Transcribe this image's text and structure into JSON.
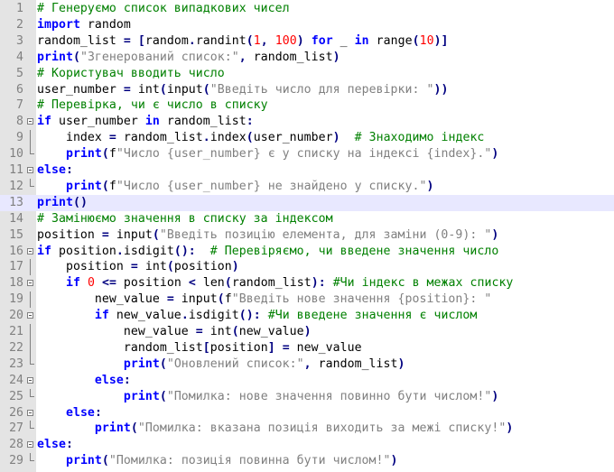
{
  "editor": {
    "language": "python",
    "current_line": 13,
    "colors": {
      "comment": "#008000",
      "keyword": "#0000ff",
      "string": "#808080",
      "number": "#ff0000",
      "operator": "#000080",
      "gutter": "#e4e4e4",
      "current_line": "#e8e8ff"
    },
    "lines": [
      {
        "n": "1",
        "fold": "",
        "tokens": [
          {
            "c": "comment",
            "t": "# Генеруємо список випадкових чисел"
          }
        ]
      },
      {
        "n": "2",
        "fold": "",
        "tokens": [
          {
            "c": "kw",
            "t": "import"
          },
          {
            "c": "id",
            "t": " random"
          }
        ]
      },
      {
        "n": "3",
        "fold": "",
        "tokens": [
          {
            "c": "id",
            "t": "random_list "
          },
          {
            "c": "op",
            "t": "="
          },
          {
            "c": "id",
            "t": " "
          },
          {
            "c": "op",
            "t": "["
          },
          {
            "c": "id",
            "t": "random"
          },
          {
            "c": "op",
            "t": "."
          },
          {
            "c": "id",
            "t": "randint"
          },
          {
            "c": "op",
            "t": "("
          },
          {
            "c": "num",
            "t": "1"
          },
          {
            "c": "op",
            "t": ","
          },
          {
            "c": "id",
            "t": " "
          },
          {
            "c": "num",
            "t": "100"
          },
          {
            "c": "op",
            "t": ")"
          },
          {
            "c": "id",
            "t": " "
          },
          {
            "c": "kw",
            "t": "for"
          },
          {
            "c": "id",
            "t": " _ "
          },
          {
            "c": "kw",
            "t": "in"
          },
          {
            "c": "id",
            "t": " range"
          },
          {
            "c": "op",
            "t": "("
          },
          {
            "c": "num",
            "t": "10"
          },
          {
            "c": "op",
            "t": ")]"
          }
        ]
      },
      {
        "n": "4",
        "fold": "",
        "tokens": [
          {
            "c": "kw",
            "t": "print"
          },
          {
            "c": "op",
            "t": "("
          },
          {
            "c": "str",
            "t": "\"Згенерований список:\""
          },
          {
            "c": "op",
            "t": ","
          },
          {
            "c": "id",
            "t": " random_list"
          },
          {
            "c": "op",
            "t": ")"
          }
        ]
      },
      {
        "n": "5",
        "fold": "",
        "tokens": [
          {
            "c": "comment",
            "t": "# Користувач вводить число"
          }
        ]
      },
      {
        "n": "6",
        "fold": "",
        "tokens": [
          {
            "c": "id",
            "t": "user_number "
          },
          {
            "c": "op",
            "t": "="
          },
          {
            "c": "id",
            "t": " int"
          },
          {
            "c": "op",
            "t": "("
          },
          {
            "c": "id",
            "t": "input"
          },
          {
            "c": "op",
            "t": "("
          },
          {
            "c": "str",
            "t": "\"Введіть число для перевірки: \""
          },
          {
            "c": "op",
            "t": "))"
          }
        ]
      },
      {
        "n": "7",
        "fold": "",
        "tokens": [
          {
            "c": "comment",
            "t": "# Перевірка, чи є число в списку"
          }
        ]
      },
      {
        "n": "8",
        "fold": "box",
        "tokens": [
          {
            "c": "kw",
            "t": "if"
          },
          {
            "c": "id",
            "t": " user_number "
          },
          {
            "c": "kw",
            "t": "in"
          },
          {
            "c": "id",
            "t": " random_list"
          },
          {
            "c": "op",
            "t": ":"
          }
        ]
      },
      {
        "n": "9",
        "fold": "line",
        "tokens": [
          {
            "c": "id",
            "t": "    index "
          },
          {
            "c": "op",
            "t": "="
          },
          {
            "c": "id",
            "t": " random_list"
          },
          {
            "c": "op",
            "t": "."
          },
          {
            "c": "id",
            "t": "index"
          },
          {
            "c": "op",
            "t": "("
          },
          {
            "c": "id",
            "t": "user_number"
          },
          {
            "c": "op",
            "t": ")"
          },
          {
            "c": "id",
            "t": "  "
          },
          {
            "c": "comment",
            "t": "# Знаходимо індекс"
          }
        ]
      },
      {
        "n": "10",
        "fold": "end",
        "tokens": [
          {
            "c": "id",
            "t": "    "
          },
          {
            "c": "kw",
            "t": "print"
          },
          {
            "c": "op",
            "t": "("
          },
          {
            "c": "id",
            "t": "f"
          },
          {
            "c": "str",
            "t": "\"Число {user_number} є у списку на індексі {index}.\""
          },
          {
            "c": "op",
            "t": ")"
          }
        ]
      },
      {
        "n": "11",
        "fold": "box",
        "tokens": [
          {
            "c": "kw",
            "t": "else"
          },
          {
            "c": "op",
            "t": ":"
          }
        ]
      },
      {
        "n": "12",
        "fold": "end",
        "tokens": [
          {
            "c": "id",
            "t": "    "
          },
          {
            "c": "kw",
            "t": "print"
          },
          {
            "c": "op",
            "t": "("
          },
          {
            "c": "id",
            "t": "f"
          },
          {
            "c": "str",
            "t": "\"Число {user_number} не знайдено у списку.\""
          },
          {
            "c": "op",
            "t": ")"
          }
        ]
      },
      {
        "n": "13",
        "fold": "",
        "tokens": [
          {
            "c": "kw",
            "t": "print"
          },
          {
            "c": "op",
            "t": "()"
          }
        ]
      },
      {
        "n": "14",
        "fold": "",
        "tokens": [
          {
            "c": "comment",
            "t": "# Замінюємо значення в списку за індексом"
          }
        ]
      },
      {
        "n": "15",
        "fold": "",
        "tokens": [
          {
            "c": "id",
            "t": "position "
          },
          {
            "c": "op",
            "t": "="
          },
          {
            "c": "id",
            "t": " input"
          },
          {
            "c": "op",
            "t": "("
          },
          {
            "c": "str",
            "t": "\"Введіть позицію елемента, для заміни (0-9): \""
          },
          {
            "c": "op",
            "t": ")"
          }
        ]
      },
      {
        "n": "16",
        "fold": "box",
        "tokens": [
          {
            "c": "kw",
            "t": "if"
          },
          {
            "c": "id",
            "t": " position"
          },
          {
            "c": "op",
            "t": "."
          },
          {
            "c": "id",
            "t": "isdigit"
          },
          {
            "c": "op",
            "t": "():"
          },
          {
            "c": "id",
            "t": "  "
          },
          {
            "c": "comment",
            "t": "# Перевіряємо, чи введене значення число"
          }
        ]
      },
      {
        "n": "17",
        "fold": "line",
        "tokens": [
          {
            "c": "id",
            "t": "    position "
          },
          {
            "c": "op",
            "t": "="
          },
          {
            "c": "id",
            "t": " int"
          },
          {
            "c": "op",
            "t": "("
          },
          {
            "c": "id",
            "t": "position"
          },
          {
            "c": "op",
            "t": ")"
          }
        ]
      },
      {
        "n": "18",
        "fold": "box",
        "tokens": [
          {
            "c": "id",
            "t": "    "
          },
          {
            "c": "kw",
            "t": "if"
          },
          {
            "c": "id",
            "t": " "
          },
          {
            "c": "num",
            "t": "0"
          },
          {
            "c": "id",
            "t": " "
          },
          {
            "c": "op",
            "t": "<="
          },
          {
            "c": "id",
            "t": " position "
          },
          {
            "c": "op",
            "t": "<"
          },
          {
            "c": "id",
            "t": " len"
          },
          {
            "c": "op",
            "t": "("
          },
          {
            "c": "id",
            "t": "random_list"
          },
          {
            "c": "op",
            "t": "):"
          },
          {
            "c": "id",
            "t": " "
          },
          {
            "c": "comment",
            "t": "#Чи індекс в межах списку"
          }
        ]
      },
      {
        "n": "19",
        "fold": "line",
        "tokens": [
          {
            "c": "id",
            "t": "        new_value "
          },
          {
            "c": "op",
            "t": "="
          },
          {
            "c": "id",
            "t": " input"
          },
          {
            "c": "op",
            "t": "("
          },
          {
            "c": "id",
            "t": "f"
          },
          {
            "c": "str",
            "t": "\"Введіть нове значення {position}: \""
          }
        ]
      },
      {
        "n": "20",
        "fold": "box",
        "tokens": [
          {
            "c": "id",
            "t": "        "
          },
          {
            "c": "kw",
            "t": "if"
          },
          {
            "c": "id",
            "t": " new_value"
          },
          {
            "c": "op",
            "t": "."
          },
          {
            "c": "id",
            "t": "isdigit"
          },
          {
            "c": "op",
            "t": "():"
          },
          {
            "c": "id",
            "t": " "
          },
          {
            "c": "comment",
            "t": "#Чи введене значення є числом"
          }
        ]
      },
      {
        "n": "21",
        "fold": "line",
        "tokens": [
          {
            "c": "id",
            "t": "            new_value "
          },
          {
            "c": "op",
            "t": "="
          },
          {
            "c": "id",
            "t": " int"
          },
          {
            "c": "op",
            "t": "("
          },
          {
            "c": "id",
            "t": "new_value"
          },
          {
            "c": "op",
            "t": ")"
          }
        ]
      },
      {
        "n": "22",
        "fold": "line",
        "tokens": [
          {
            "c": "id",
            "t": "            random_list"
          },
          {
            "c": "op",
            "t": "["
          },
          {
            "c": "id",
            "t": "position"
          },
          {
            "c": "op",
            "t": "]"
          },
          {
            "c": "id",
            "t": " "
          },
          {
            "c": "op",
            "t": "="
          },
          {
            "c": "id",
            "t": " new_value"
          }
        ]
      },
      {
        "n": "23",
        "fold": "end",
        "tokens": [
          {
            "c": "id",
            "t": "            "
          },
          {
            "c": "kw",
            "t": "print"
          },
          {
            "c": "op",
            "t": "("
          },
          {
            "c": "str",
            "t": "\"Оновлений список:\""
          },
          {
            "c": "op",
            "t": ","
          },
          {
            "c": "id",
            "t": " random_list"
          },
          {
            "c": "op",
            "t": ")"
          }
        ]
      },
      {
        "n": "24",
        "fold": "box",
        "tokens": [
          {
            "c": "id",
            "t": "        "
          },
          {
            "c": "kw",
            "t": "else"
          },
          {
            "c": "op",
            "t": ":"
          }
        ]
      },
      {
        "n": "25",
        "fold": "end",
        "tokens": [
          {
            "c": "id",
            "t": "            "
          },
          {
            "c": "kw",
            "t": "print"
          },
          {
            "c": "op",
            "t": "("
          },
          {
            "c": "str",
            "t": "\"Помилка: нове значення повинно бути числом!\""
          },
          {
            "c": "op",
            "t": ")"
          }
        ]
      },
      {
        "n": "26",
        "fold": "box",
        "tokens": [
          {
            "c": "id",
            "t": "    "
          },
          {
            "c": "kw",
            "t": "else"
          },
          {
            "c": "op",
            "t": ":"
          }
        ]
      },
      {
        "n": "27",
        "fold": "end",
        "tokens": [
          {
            "c": "id",
            "t": "        "
          },
          {
            "c": "kw",
            "t": "print"
          },
          {
            "c": "op",
            "t": "("
          },
          {
            "c": "str",
            "t": "\"Помилка: вказана позиція виходить за межі списку!\""
          },
          {
            "c": "op",
            "t": ")"
          }
        ]
      },
      {
        "n": "28",
        "fold": "box",
        "tokens": [
          {
            "c": "kw",
            "t": "else"
          },
          {
            "c": "op",
            "t": ":"
          }
        ]
      },
      {
        "n": "29",
        "fold": "end",
        "tokens": [
          {
            "c": "id",
            "t": "    "
          },
          {
            "c": "kw",
            "t": "print"
          },
          {
            "c": "op",
            "t": "("
          },
          {
            "c": "str",
            "t": "\"Помилка: позиція повинна бути числом!\""
          },
          {
            "c": "op",
            "t": ")"
          }
        ]
      }
    ]
  }
}
